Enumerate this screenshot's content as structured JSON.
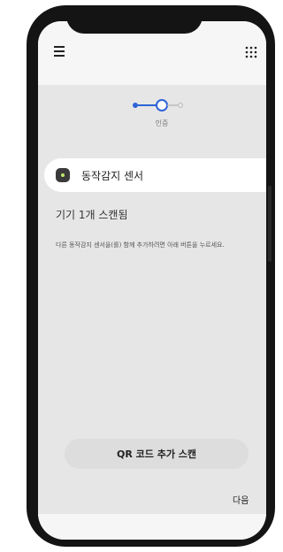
{
  "progress": {
    "step_label": "인증"
  },
  "device": {
    "name": "동작감지 센서",
    "icon": "motion-sensor-icon"
  },
  "scan": {
    "count_text": "기기 1개 스캔됨",
    "instruction": "다른 동작감지 센서을(를) 함께 추가하려면 아래 버튼을 누르세요."
  },
  "actions": {
    "qr_label": "QR 코드 추가 스캔",
    "next_label": "다음"
  },
  "icons": {
    "menu": "hamburger-menu-icon",
    "apps": "grid-apps-icon"
  },
  "colors": {
    "accent": "#2e63d6",
    "background": "#e6e6e6"
  }
}
